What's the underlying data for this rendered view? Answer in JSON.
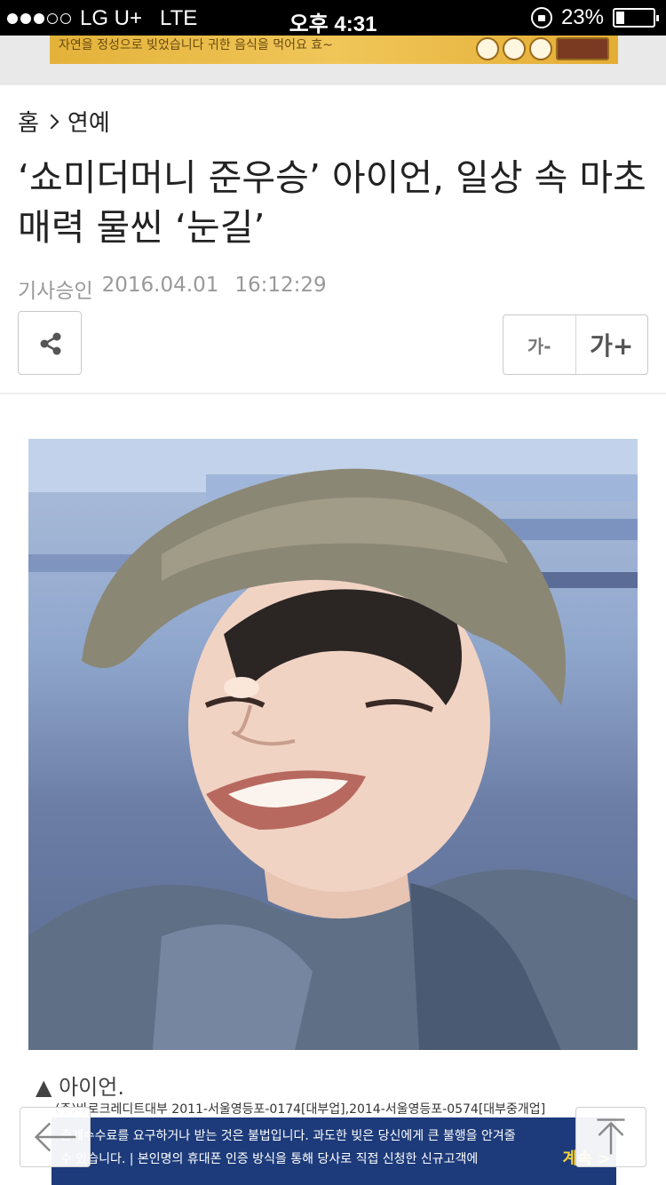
{
  "status_bar": {
    "carrier": "LG U+",
    "network": "LTE",
    "time": "오후 4:31",
    "battery_text": "23%",
    "battery_level": 0.23,
    "signal_bars": 3,
    "signal_total": 5
  },
  "top_ad": {
    "text": "자연을 정성으로 빚었습니다   귀한 음식을 먹어요 효~"
  },
  "breadcrumb": {
    "home": "홈",
    "section": "연예"
  },
  "article": {
    "title": "‘쇼미더머니 준우승’ 아이언, 일상 속 마초 매력 물씬 ‘눈길’",
    "approved_label": "기사승인",
    "date": "2016.04.01",
    "time": "16:12:29",
    "photo_caption": "▲ 아이언."
  },
  "font_controls": {
    "decrease": "가-",
    "increase": "가+"
  },
  "bottom_ad": {
    "line1": "(주)바로크레디트대부 2011-서울영등포-0174[대부업],2014-서울영등포-0574[대부중개업]",
    "line2": "중개수수료를 요구하거나 받는 것은 불법입니다. 과도한 빚은 당신에게 큰 불행을 안겨줄",
    "line3": "수 있습니다. | 본인명의 휴대폰 인증 방식을 통해 당사로 직접 신청한 신규고객에",
    "cta": "계속 >"
  },
  "icons": {
    "share": "share-icon",
    "back": "back-arrow-icon",
    "scroll_top": "arrow-up-icon"
  }
}
